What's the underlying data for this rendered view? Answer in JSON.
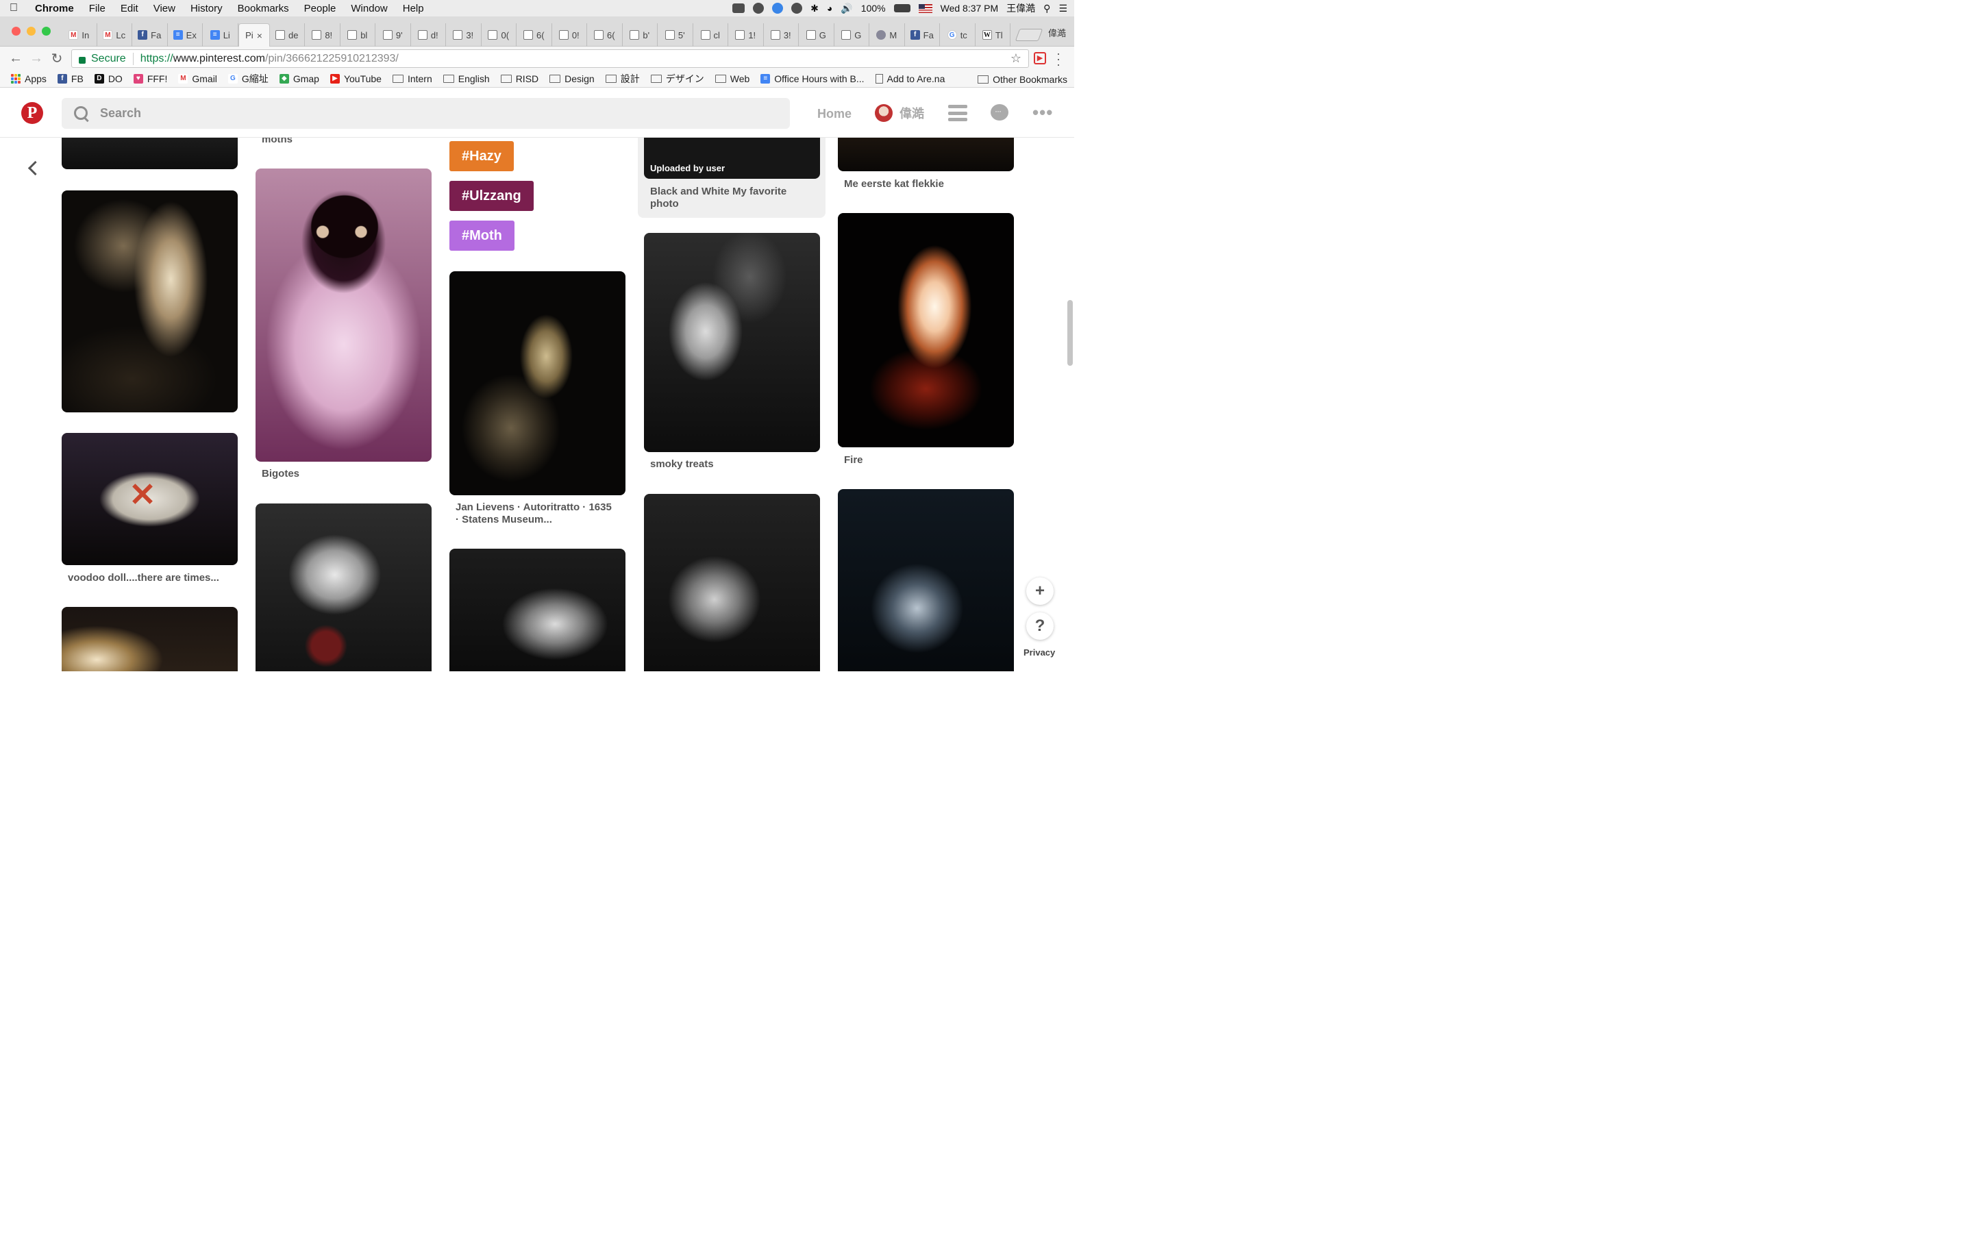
{
  "menubar": {
    "app_name": "Chrome",
    "items": [
      "File",
      "Edit",
      "View",
      "History",
      "Bookmarks",
      "People",
      "Window",
      "Help"
    ],
    "battery": "100%",
    "clock": "Wed 8:37 PM",
    "user": "王偉澔"
  },
  "tabs": [
    {
      "favicon": "gmail-icon",
      "label": "In"
    },
    {
      "favicon": "gmail-icon",
      "label": "Lc"
    },
    {
      "favicon": "facebook-icon",
      "label": "Fa"
    },
    {
      "favicon": "docs-icon",
      "label": "Ex"
    },
    {
      "favicon": "docs-icon",
      "label": "Li"
    },
    {
      "favicon": "none",
      "label": "Pi",
      "active": true
    },
    {
      "favicon": "page-icon",
      "label": "de"
    },
    {
      "favicon": "page-icon",
      "label": "8!"
    },
    {
      "favicon": "page-icon",
      "label": "bl"
    },
    {
      "favicon": "page-icon",
      "label": "9'"
    },
    {
      "favicon": "page-icon",
      "label": "d!"
    },
    {
      "favicon": "page-icon",
      "label": "3!"
    },
    {
      "favicon": "page-icon",
      "label": "0("
    },
    {
      "favicon": "page-icon",
      "label": "6("
    },
    {
      "favicon": "page-icon",
      "label": "0!"
    },
    {
      "favicon": "page-icon",
      "label": "6("
    },
    {
      "favicon": "page-icon",
      "label": "b'"
    },
    {
      "favicon": "page-icon",
      "label": "5'"
    },
    {
      "favicon": "page-icon",
      "label": "cl"
    },
    {
      "favicon": "page-icon",
      "label": "1!"
    },
    {
      "favicon": "page-icon",
      "label": "3!"
    },
    {
      "favicon": "page-icon",
      "label": "G"
    },
    {
      "favicon": "page-icon",
      "label": "G"
    },
    {
      "favicon": "image-icon",
      "label": "M"
    },
    {
      "favicon": "facebook-icon",
      "label": "Fa"
    },
    {
      "favicon": "google-icon",
      "label": "tc"
    },
    {
      "favicon": "wikipedia-icon",
      "label": "Tl"
    }
  ],
  "profile_name": "偉澔",
  "toolbar": {
    "secure_label": "Secure",
    "url_scheme": "https://",
    "url_host": "www.pinterest.com",
    "url_path": "/pin/366621225910212393/"
  },
  "bookmarks": [
    {
      "icon": "apps-grid-icon",
      "label": "Apps"
    },
    {
      "icon": "facebook-icon",
      "label": "FB"
    },
    {
      "icon": "do-icon",
      "label": "DO"
    },
    {
      "icon": "heart-icon",
      "label": "FFF!"
    },
    {
      "icon": "gmail-icon",
      "label": "Gmail"
    },
    {
      "icon": "google-icon",
      "label": "G縮址"
    },
    {
      "icon": "maps-icon",
      "label": "Gmap"
    },
    {
      "icon": "youtube-icon",
      "label": "YouTube"
    },
    {
      "icon": "folder-icon",
      "label": "Intern"
    },
    {
      "icon": "folder-icon",
      "label": "English"
    },
    {
      "icon": "folder-icon",
      "label": "RISD"
    },
    {
      "icon": "folder-icon",
      "label": "Design"
    },
    {
      "icon": "folder-icon",
      "label": "設計"
    },
    {
      "icon": "folder-icon",
      "label": "デザイン"
    },
    {
      "icon": "folder-icon",
      "label": "Web"
    },
    {
      "icon": "docs-icon",
      "label": "Office Hours with B..."
    },
    {
      "icon": "page-icon",
      "label": "Add to Are.na"
    }
  ],
  "other_bookmarks": "Other Bookmarks",
  "pinterest": {
    "search_placeholder": "Search",
    "home_label": "Home",
    "user_name": "偉澔",
    "brand_color": "#cb2027"
  },
  "tags": [
    {
      "label": "#Hazy",
      "color": "#e57a27"
    },
    {
      "label": "#Ulzzang",
      "color": "#7a1e4e"
    },
    {
      "label": "#Moth",
      "color": "#b46be0"
    }
  ],
  "pins": {
    "moths_caption": "moths",
    "voodoo_caption": "voodoo doll....there are times...",
    "cat_caption": "Bigotes",
    "lievens_caption_1": "Jan Lievens · Autoritratto · 1635",
    "lievens_caption_2": "· Statens Museum...",
    "uploaded_label": "Uploaded by user",
    "bw_caption_1": "Black and White My favorite",
    "bw_caption_2": "photo",
    "smoky_caption": "smoky treats",
    "kat_caption": "Me eerste kat flekkie",
    "fire_caption": "Fire"
  },
  "float": {
    "plus": "+",
    "help": "?",
    "privacy": "Privacy"
  }
}
